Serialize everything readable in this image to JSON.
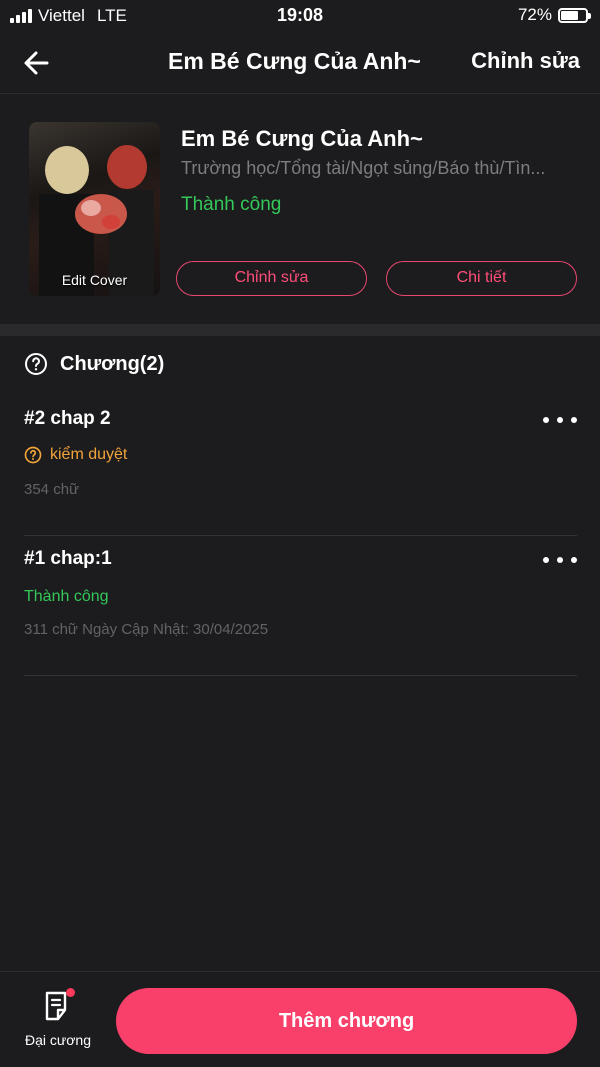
{
  "status_bar": {
    "carrier": "Viettel",
    "network": "LTE",
    "time": "19:08",
    "battery_percent": "72%",
    "battery_level": 0.72
  },
  "nav": {
    "back_icon": "arrow-left-icon",
    "title": "Em Bé Cưng Của Anh~",
    "edit_label": "Chỉnh sửa"
  },
  "book": {
    "cover_caption": "Edit Cover",
    "title": "Em Bé Cưng Của Anh~",
    "genres": "Trường học/Tổng tài/Ngọt sủng/Báo thù/Tìn...",
    "status": "Thành công",
    "edit_button": "Chỉnh sửa",
    "detail_button": "Chi tiết"
  },
  "chapters": {
    "header": "Chương(2)",
    "items": [
      {
        "name": "#2 chap 2",
        "status": "kiểm duyệt",
        "meta": "354 chữ"
      },
      {
        "name": "#1 chap:1",
        "status": "Thành công",
        "meta": "311 chữ Ngày Cập Nhật: 30/04/2025"
      }
    ]
  },
  "bottom": {
    "outline_label": "Đại cương",
    "add_chapter_label": "Thêm chương"
  },
  "colors": {
    "background": "#1c1c1e",
    "accent": "#f9406b",
    "success": "#34c759",
    "review": "#f2a33a",
    "muted": "#7d7d80"
  }
}
